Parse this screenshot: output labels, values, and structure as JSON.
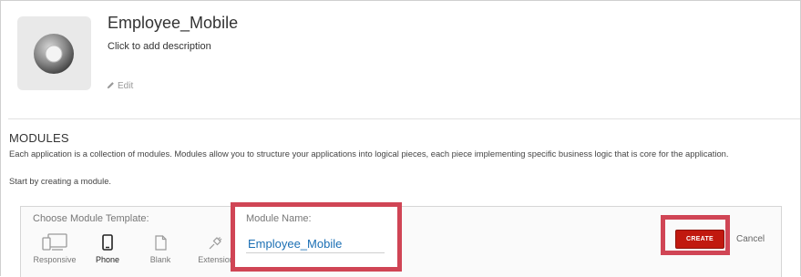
{
  "app": {
    "title": "Employee_Mobile",
    "description_placeholder": "Click to add description",
    "edit_label": "Edit",
    "icon": "disc-icon"
  },
  "modules": {
    "title": "MODULES",
    "description": "Each application is a collection of modules. Modules allow you to structure your applications into logical pieces, each piece implementing specific business logic that is core for the application.",
    "start_text": "Start by creating a module."
  },
  "template_chooser": {
    "label": "Choose Module Template:",
    "templates": [
      {
        "label": "Responsive",
        "icon": "responsive-icon",
        "selected": false
      },
      {
        "label": "Phone",
        "icon": "phone-icon",
        "selected": true
      },
      {
        "label": "Blank",
        "icon": "blank-page-icon",
        "selected": false
      },
      {
        "label": "Extension",
        "icon": "plug-icon",
        "selected": false
      }
    ]
  },
  "module_name": {
    "label": "Module Name:",
    "value": "Employee_Mobile"
  },
  "actions": {
    "create_label": "CREATE",
    "cancel_label": "Cancel"
  },
  "colors": {
    "highlight": "#d04555",
    "create_button": "#c1190f",
    "input_text": "#1b6fb4"
  }
}
